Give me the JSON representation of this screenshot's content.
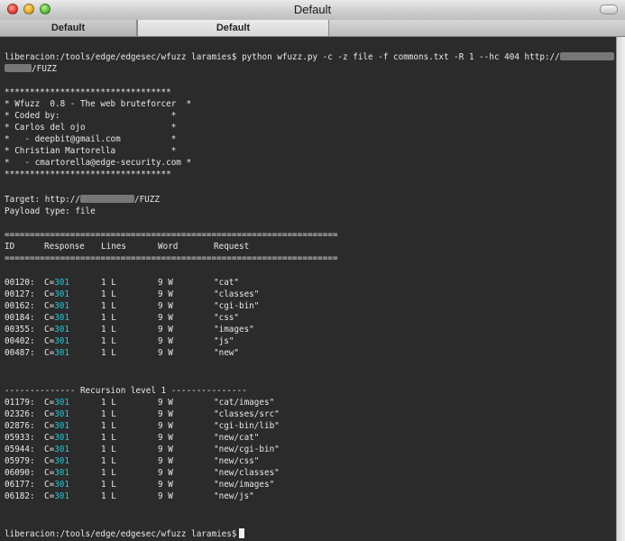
{
  "window": {
    "title": "Default"
  },
  "tabs": [
    {
      "label": "Default"
    },
    {
      "label": "Default"
    }
  ],
  "command": {
    "prompt": "liberacion:/tools/edge/edgesec/wfuzz laramies$",
    "text": "python wfuzz.py -c -z file -f commons.txt -R 1 --hc 404 http://",
    "continuation": "/FUZZ"
  },
  "banner": [
    "*********************************",
    "* Wfuzz  0.8 - The web bruteforcer  *",
    "* Coded by:                      *",
    "* Carlos del ojo                 *",
    "*   - deepbit@gmail.com          *",
    "* Christian Martorella           *",
    "*   - cmartorella@edge-security.com *",
    "*********************************"
  ],
  "target": {
    "label": "Target: http://",
    "suffix": "/FUZZ"
  },
  "payload": "Payload type: file",
  "separator": "==================================================================",
  "headers": {
    "id": "ID",
    "response": "Response",
    "lines": "Lines",
    "word": "Word",
    "request": "Request"
  },
  "results": [
    {
      "id": "00120:",
      "resp_prefix": "C=",
      "code": "301",
      "lines": "1 L",
      "word": "9 W",
      "request": "\"cat\""
    },
    {
      "id": "00127:",
      "resp_prefix": "C=",
      "code": "301",
      "lines": "1 L",
      "word": "9 W",
      "request": "\"classes\""
    },
    {
      "id": "00162:",
      "resp_prefix": "C=",
      "code": "301",
      "lines": "1 L",
      "word": "9 W",
      "request": "\"cgi-bin\""
    },
    {
      "id": "00184:",
      "resp_prefix": "C=",
      "code": "301",
      "lines": "1 L",
      "word": "9 W",
      "request": "\"css\""
    },
    {
      "id": "00355:",
      "resp_prefix": "C=",
      "code": "301",
      "lines": "1 L",
      "word": "9 W",
      "request": "\"images\""
    },
    {
      "id": "00402:",
      "resp_prefix": "C=",
      "code": "301",
      "lines": "1 L",
      "word": "9 W",
      "request": "\"js\""
    },
    {
      "id": "00487:",
      "resp_prefix": "C=",
      "code": "301",
      "lines": "1 L",
      "word": "9 W",
      "request": "\"new\""
    }
  ],
  "recursion_header": "-------------- Recursion level 1 ---------------",
  "recursion_results": [
    {
      "id": "01179:",
      "resp_prefix": "C=",
      "code": "301",
      "lines": "1 L",
      "word": "9 W",
      "request": "\"cat/images\""
    },
    {
      "id": "02326:",
      "resp_prefix": "C=",
      "code": "301",
      "lines": "1 L",
      "word": "9 W",
      "request": "\"classes/src\""
    },
    {
      "id": "02876:",
      "resp_prefix": "C=",
      "code": "301",
      "lines": "1 L",
      "word": "9 W",
      "request": "\"cgi-bin/lib\""
    },
    {
      "id": "05933:",
      "resp_prefix": "C=",
      "code": "301",
      "lines": "1 L",
      "word": "9 W",
      "request": "\"new/cat\""
    },
    {
      "id": "05944:",
      "resp_prefix": "C=",
      "code": "301",
      "lines": "1 L",
      "word": "9 W",
      "request": "\"new/cgi-bin\""
    },
    {
      "id": "05979:",
      "resp_prefix": "C=",
      "code": "301",
      "lines": "1 L",
      "word": "9 W",
      "request": "\"new/css\""
    },
    {
      "id": "06090:",
      "resp_prefix": "C=",
      "code": "301",
      "lines": "1 L",
      "word": "9 W",
      "request": "\"new/classes\""
    },
    {
      "id": "06177:",
      "resp_prefix": "C=",
      "code": "301",
      "lines": "1 L",
      "word": "9 W",
      "request": "\"new/images\""
    },
    {
      "id": "06182:",
      "resp_prefix": "C=",
      "code": "301",
      "lines": "1 L",
      "word": "9 W",
      "request": "\"new/js\""
    }
  ],
  "final_prompt": "liberacion:/tools/edge/edgesec/wfuzz laramies$",
  "colors": {
    "status_code": "#29c6d6",
    "terminal_bg": "#2b2b2b",
    "terminal_text": "#e8e8e8"
  }
}
